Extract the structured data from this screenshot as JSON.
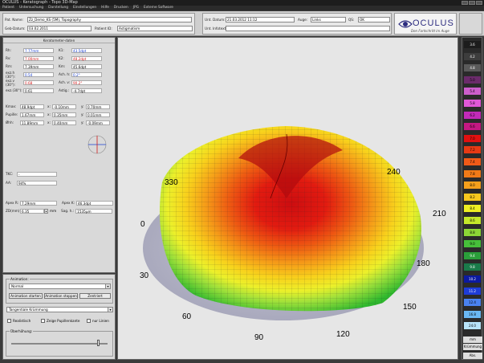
{
  "window": {
    "title": "OCULUS - Keratograph - Topo 3D-Map"
  },
  "menu": [
    "Patient",
    "Untersuchung",
    "Darstellung",
    "Einstellungen",
    "Hilfe",
    "Drucken",
    "JPG",
    "Externe Software"
  ],
  "header": {
    "pat_name_label": "Pat. Name:",
    "pat_name": "Zz_Demo_KS (5M), Topography",
    "geb_label": "Geb-Datum:",
    "geb": "03.02.2011",
    "patient_id_label": "Patient ID:",
    "patient_id": "Astigmatism",
    "unt_datum_label": "Unt. Datum:",
    "unt_datum": "21.03.2012 11:12",
    "auge_label": "Auge:",
    "auge": "Links",
    "qs_label": "QS:",
    "qs": "OK",
    "unt_info_label": "Unt. Infotext:",
    "unt_info": ""
  },
  "logo": {
    "brand": "OCULUS",
    "tagline": "Den Fortschritt im Auge"
  },
  "kerato": {
    "title": "Keratometer-daten",
    "rows": [
      {
        "k1": "Rh:",
        "v1": "7.77mm",
        "c1": "blue",
        "k2": "K1:",
        "v2": "43.5dpt",
        "c2": "blue"
      },
      {
        "k1": "Rv:",
        "v1": "7.00mm",
        "c1": "red",
        "k2": "K2:",
        "v2": "48.2dpt",
        "c2": "red"
      },
      {
        "k1": "Rm:",
        "v1": "7.39mm",
        "c1": "",
        "k2": "Km:",
        "v2": "45.6dpt",
        "c2": ""
      },
      {
        "k1": "exz.h (30°):",
        "v1": "0.54",
        "c1": "blue",
        "k2": "Ach. h:",
        "v2": "0.2°",
        "c2": "blue"
      },
      {
        "k1": "exz.v (30°):",
        "v1": "0.68",
        "c1": "red",
        "k2": "Ach. v:",
        "v2": "90.2°",
        "c2": "red"
      },
      {
        "k1": "exz.(30°):",
        "v1": "0.61",
        "c1": "",
        "k2": "Astig.:",
        "v2": "-4.7dpt",
        "c2": ""
      }
    ],
    "rows2": [
      {
        "k1": "Kmax:",
        "v1": "48.9dpt",
        "k2": "x:",
        "v2": "-0.10mm",
        "k3": "y:",
        "v3": "0.70mm"
      },
      {
        "k1": "Pupille:",
        "v1": "1.67mm",
        "k2": "x:",
        "v2": "0.35mm",
        "k3": "y:",
        "v3": "0.01mm"
      },
      {
        "k1": "Øhh:",
        "v1": "11.89mm",
        "k2": "x:",
        "v2": "0.40mm",
        "k3": "y:",
        "v3": "-0.09mm"
      }
    ],
    "tkc_label": "TKC:",
    "tkc": "-",
    "aa_label": "AA:",
    "aa": "94%",
    "apex_r_label": "Apex R:",
    "apex_r": "7.29mm",
    "apex_k_label": "Apex K:",
    "apex_k": "46.3dpt",
    "zd_label": "ZD(mm):",
    "zd": "6.35",
    "sag_label": "Sag. h.:",
    "sag": "1535µm",
    "zd_unit": "mm"
  },
  "animation": {
    "group_title": "Animation:",
    "mode": "Normal",
    "start": "Animation starten",
    "stop": "Animation stoppen",
    "center": "Zentriert",
    "map_type": "Tangentiale Krümmung",
    "cb1": "Realistisch",
    "cb2": "Zeige Pupillenkante",
    "cb3": "nur Linien",
    "overhoehung": "Überhöhung:"
  },
  "axis_labels": [
    "0",
    "30",
    "60",
    "90",
    "120",
    "150",
    "180",
    "210",
    "240",
    "330"
  ],
  "colors": {
    "bg_view": "#e6e6e6",
    "header": "#cfcfcf"
  },
  "scale": {
    "values": [
      "3.6",
      "4.2",
      "4.8",
      "5.0",
      "5.4",
      "5.8",
      "6.2",
      "6.6",
      "7.0",
      "7.2",
      "7.4",
      "7.8",
      "8.0",
      "8.2",
      "8.4",
      "8.6",
      "8.8",
      "9.0",
      "9.4",
      "9.8",
      "10.2",
      "11.2",
      "12.4",
      "16.8",
      "24.0"
    ],
    "unit": "mm",
    "type": "Krümmung",
    "abs": "Abs."
  }
}
